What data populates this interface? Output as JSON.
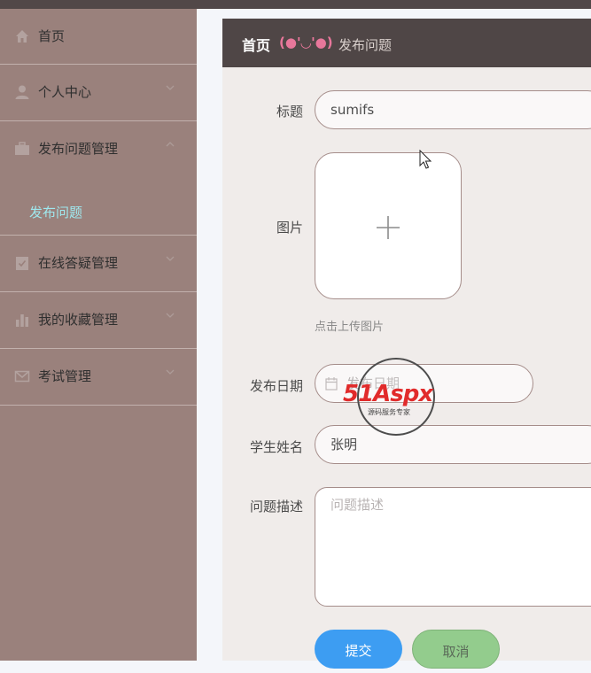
{
  "sidebar": {
    "items": [
      {
        "label": "首页",
        "icon": "home-icon"
      },
      {
        "label": "个人中心",
        "icon": "user-icon"
      },
      {
        "label": "发布问题管理",
        "icon": "briefcase-icon",
        "expanded": true
      },
      {
        "label": "在线答疑管理",
        "icon": "clipboard-icon"
      },
      {
        "label": "我的收藏管理",
        "icon": "bar-chart-icon"
      },
      {
        "label": "考试管理",
        "icon": "mail-icon"
      }
    ],
    "subitem": {
      "label": "发布问题"
    }
  },
  "header": {
    "home": "首页",
    "separator": "(●'◡'●)",
    "current": "发布问题"
  },
  "form": {
    "title": {
      "label": "标题",
      "value": "sumifs"
    },
    "image": {
      "label": "图片",
      "hint": "点击上传图片"
    },
    "date": {
      "label": "发布日期",
      "placeholder": "发布日期"
    },
    "student": {
      "label": "学生姓名",
      "value": "张明"
    },
    "description": {
      "label": "问题描述",
      "placeholder": "问题描述"
    },
    "submit_label": "提交",
    "cancel_label": "取消"
  },
  "watermark": {
    "brand": "51Aspx",
    "tagline": "源码服务专家"
  },
  "colors": {
    "topbar": "#524848",
    "sidebar": "#9a817c",
    "submenu_text": "#9fe8ee",
    "header": "#4f4646",
    "separator": "#e8779b",
    "submit": "#3d9df2",
    "cancel": "#93cc8d"
  }
}
